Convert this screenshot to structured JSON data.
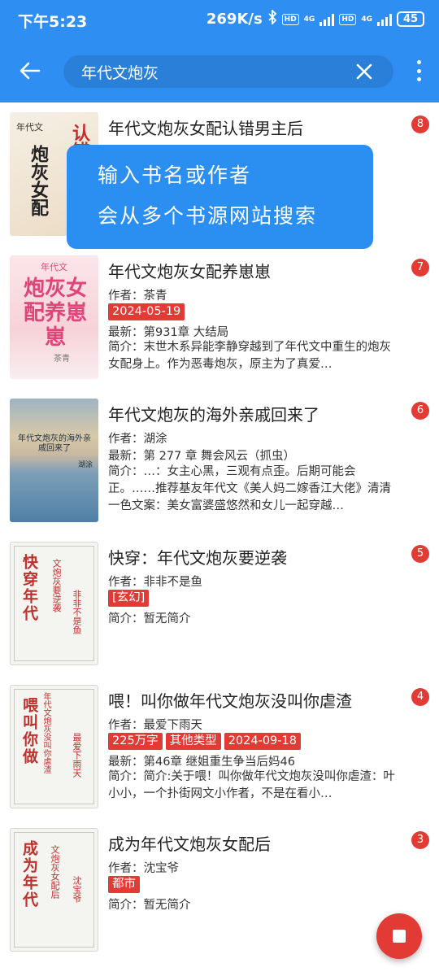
{
  "status": {
    "time": "下午5:23",
    "speed": "269K/s",
    "net1": "4G",
    "net2": "4G",
    "hd": "HD",
    "battery": "45"
  },
  "search": {
    "query": "年代文炮灰"
  },
  "tooltip": {
    "line1": "输入书名或作者",
    "line2": "会从多个书源网站搜索"
  },
  "results": [
    {
      "title": "年代文炮灰女配认错男主后",
      "count": "8",
      "author": "",
      "tags": [],
      "latest": "",
      "intro": "",
      "cover": {
        "text": "认错男主后",
        "sub": "年代文",
        "author": ""
      }
    },
    {
      "title": "年代文炮灰女配养崽崽",
      "count": "7",
      "author": "作者：茶青",
      "tags": [
        "2024-05-19"
      ],
      "latest": "最新：第931章 大结局",
      "intro": "简介：末世木系异能李静穿越到了年代文中重生的炮灰女配身上。作为恶毒炮灰，原主为了真爱…",
      "cover": {
        "text": "炮灰女配养崽崽",
        "sub": "年代文",
        "author": "茶青"
      }
    },
    {
      "title": "年代文炮灰的海外亲戚回来了",
      "count": "6",
      "author": "作者：湖涂",
      "tags": [],
      "latest": "最新：第 277 章 舞会风云（抓虫）",
      "intro": "简介：…：女主心黑，三观有点歪。后期可能会正。……推荐基友年代文《美人妈二嫁香江大佬》清清一色文案：美女富婆盛悠然和女儿一起穿越…",
      "cover": {
        "text": "年代文炮灰的海外亲戚回来了",
        "sub": "",
        "author": "湖涂"
      }
    },
    {
      "title": "快穿：年代文炮灰要逆袭",
      "count": "5",
      "author": "作者：非非不是鱼",
      "tags": [
        "[玄幻]"
      ],
      "latest": "",
      "intro": "简介：暂无简介",
      "cover": {
        "text": "快穿年代",
        "sub": "文炮灰要逆袭",
        "author": "非非不是鱼"
      }
    },
    {
      "title": "喂！叫你做年代文炮灰没叫你虐渣",
      "count": "4",
      "author": "作者：最爱下雨天",
      "tags": [
        "225万字",
        "其他类型",
        "2024-09-18"
      ],
      "latest": "最新：第46章 继姐重生争当后妈46",
      "intro": "简介：简介:关于喂！叫你做年代文炮灰没叫你虐渣：叶小小，一个扑街网文小作者，不是在看小…",
      "cover": {
        "text": "喂叫你做",
        "sub": "年代文炮灰没叫你虐渣",
        "author": "最爱下雨天"
      }
    },
    {
      "title": "成为年代文炮灰女配后",
      "count": "3",
      "author": "作者：沈宝爷",
      "tags": [
        "都市"
      ],
      "latest": "",
      "intro": "简介：暂无简介",
      "cover": {
        "text": "成为年代",
        "sub": "文炮灰女配后",
        "author": "沈宝爷"
      }
    }
  ]
}
